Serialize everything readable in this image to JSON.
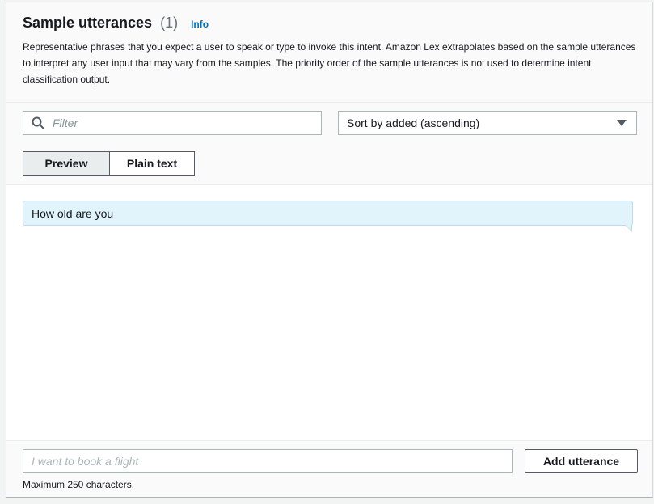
{
  "header": {
    "title": "Sample utterances",
    "count": "(1)",
    "info_label": "Info",
    "description": "Representative phrases that you expect a user to speak or type to invoke this intent. Amazon Lex extrapolates based on the sample utterances to interpret any user input that may vary from the samples. The priority order of the sample utterances is not used to determine intent classification output."
  },
  "controls": {
    "filter_placeholder": "Filter",
    "sort_selected": "Sort by added (ascending)",
    "view_modes": [
      {
        "label": "Preview",
        "selected": true
      },
      {
        "label": "Plain text",
        "selected": false
      }
    ]
  },
  "utterances": [
    {
      "text": "How old are you"
    }
  ],
  "footer": {
    "input_placeholder": "I want to book a flight",
    "add_button_label": "Add utterance",
    "hint": "Maximum 250 characters."
  },
  "colors": {
    "accent_link": "#0073bb",
    "utterance_bg": "#e1f3fb",
    "selected_segment_bg": "#eaeded"
  },
  "icons": {
    "filter": "search-icon",
    "sort": "caret-down-icon"
  }
}
